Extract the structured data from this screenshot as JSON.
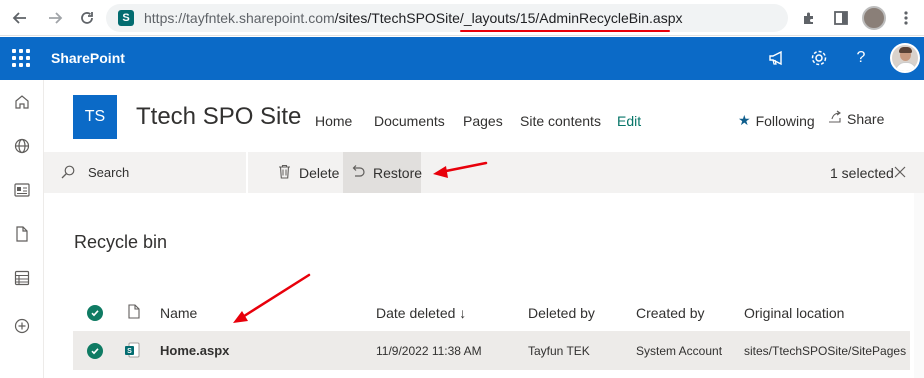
{
  "browser": {
    "url_host": "https://tayfntek.sharepoint.com",
    "url_path": "/sites/TtechSPOSite/_layouts/15/AdminRecycleBin.aspx",
    "nav_icons": [
      "back-icon",
      "forward-icon",
      "reload-icon",
      "site-info-icon"
    ],
    "toolbar_icons": [
      "extensions-icon",
      "side-panel-icon",
      "profile-icon",
      "menu-icon"
    ]
  },
  "suite": {
    "title": "SharePoint",
    "icons": [
      "app-launcher-icon",
      "megaphone-icon",
      "settings-icon",
      "help-icon",
      "user-avatar"
    ]
  },
  "rail": {
    "icons": [
      "home-icon",
      "globe-icon",
      "news-icon",
      "document-icon",
      "list-icon",
      "add-icon"
    ]
  },
  "site": {
    "logo": "TS",
    "title": "Ttech SPO Site",
    "nav": [
      "Home",
      "Documents",
      "Pages",
      "Site contents",
      "Edit"
    ],
    "following": "Following",
    "share": "Share"
  },
  "command_bar": {
    "search": "Search",
    "delete": "Delete",
    "restore": "Restore",
    "selected": "1 selected"
  },
  "page": {
    "heading": "Recycle bin"
  },
  "table": {
    "columns": [
      "Name",
      "Date deleted ↓",
      "Deleted by",
      "Created by",
      "Original location"
    ],
    "rows": [
      {
        "name": "Home.aspx",
        "date_deleted": "11/9/2022 11:38 AM",
        "deleted_by": "Tayfun TEK",
        "created_by": "System Account",
        "original_location": "sites/TtechSPOSite/SitePages",
        "selected": true
      }
    ]
  },
  "colors": {
    "suite_blue": "#0b6ac7",
    "accent_green": "#0f7b63",
    "annotation_red": "#e8000b"
  }
}
